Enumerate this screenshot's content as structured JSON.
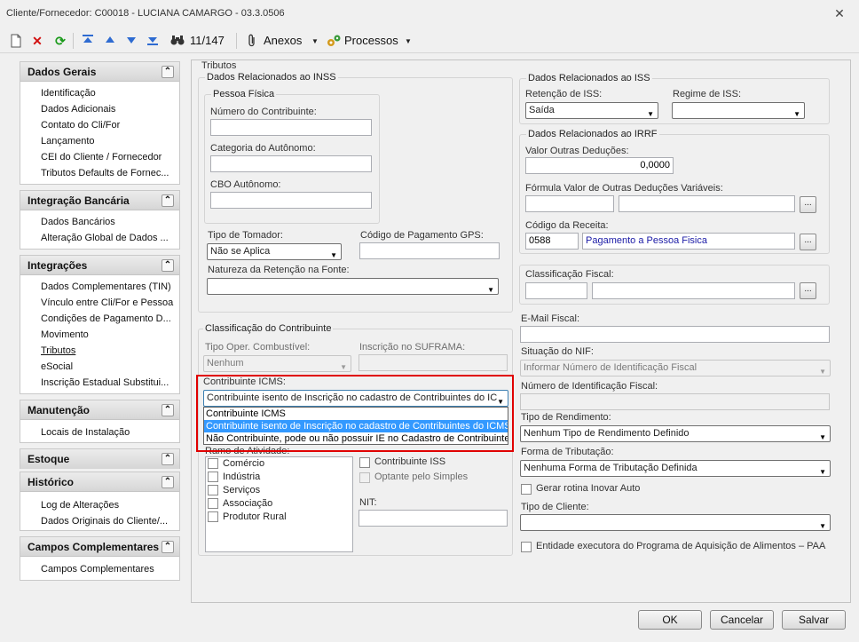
{
  "window": {
    "title": "Cliente/Fornecedor: C00018 - LUCIANA CAMARGO - 03.3.0506"
  },
  "toolbar": {
    "record_counter": "11/147",
    "anexos_label": "Anexos",
    "processos_label": "Processos"
  },
  "sidebar": {
    "dados_gerais": {
      "title": "Dados Gerais",
      "items": [
        "Identificação",
        "Dados Adicionais",
        "Contato do Cli/For",
        "Lançamento",
        "CEI do Cliente / Fornecedor",
        "Tributos Defaults de Fornec..."
      ]
    },
    "integracao_bancaria": {
      "title": "Integração Bancária",
      "items": [
        "Dados Bancários",
        "Alteração Global de Dados ..."
      ]
    },
    "integracoes": {
      "title": "Integrações",
      "items": [
        "Dados Complementares (TIN)",
        "Vínculo entre Cli/For e Pessoa",
        "Condições de Pagamento D...",
        "Movimento",
        "Tributos",
        "eSocial",
        "Inscrição Estadual Substitui..."
      ]
    },
    "manutencao": {
      "title": "Manutenção",
      "items": [
        "Locais de Instalação"
      ]
    },
    "estoque": {
      "title": "Estoque"
    },
    "historico": {
      "title": "Histórico",
      "items": [
        "Log de Alterações",
        "Dados Originais do Cliente/..."
      ]
    },
    "campos": {
      "title": "Campos Complementares",
      "items": [
        "Campos Complementares"
      ]
    }
  },
  "tributos": {
    "title": "Tributos",
    "inss": {
      "title": "Dados Relacionados ao INSS",
      "pessoa_fisica": "Pessoa Física",
      "numero_contribuinte_label": "Número do Contribuinte:",
      "numero_contribuinte_value": "",
      "categoria_autonomo_label": "Categoria do Autônomo:",
      "categoria_autonomo_value": "",
      "cbo_label": "CBO Autônomo:",
      "cbo_value": "",
      "tipo_tomador_label": "Tipo de Tomador:",
      "tipo_tomador_value": "Não se Aplica",
      "codigo_gps_label": "Código de Pagamento GPS:",
      "codigo_gps_value": "",
      "natureza_label": "Natureza da Retenção na Fonte:",
      "natureza_value": ""
    },
    "classificacao": {
      "title": "Classificação do Contribuinte",
      "tipo_oper_label": "Tipo Oper. Combustível:",
      "tipo_oper_value": "Nenhum",
      "suframa_label": "Inscrição no SUFRAMA:",
      "suframa_value": "",
      "contribuinte_icms_label": "Contribuinte ICMS:",
      "contribuinte_icms_value": "Contribuinte isento de Inscrição no cadastro de Contribuintes do IC",
      "icms_options": [
        "Contribuinte ICMS",
        "Contribuinte isento de Inscrição no cadastro de Contribuintes do ICMS",
        "Não Contribuinte, pode ou não possuir IE no Cadastro de Contribuintes"
      ],
      "ramo_label": "Ramo de Atividade:",
      "ramo_items": [
        "Comércio",
        "Indústria",
        "Serviços",
        "Associação",
        "Produtor Rural"
      ],
      "contribuinte_iss_label": "Contribuinte ISS",
      "optante_simples_label": "Optante pelo Simples",
      "nit_label": "NIT:",
      "nit_value": ""
    },
    "iss": {
      "title": "Dados Relacionados ao ISS",
      "retencao_label": "Retenção de ISS:",
      "retencao_value": "Saída",
      "regime_label": "Regime de ISS:",
      "regime_value": ""
    },
    "irrf": {
      "title": "Dados Relacionados ao IRRF",
      "valor_outras_label": "Valor Outras Deduções:",
      "valor_outras_value": "0,0000",
      "formula_label": "Fórmula Valor de Outras Deduções Variáveis:",
      "formula_code": "",
      "formula_desc": "",
      "codigo_receita_label": "Código da Receita:",
      "codigo_receita_code": "0588",
      "codigo_receita_desc": "Pagamento a Pessoa Fisica"
    },
    "classificacao_fiscal": {
      "label": "Classificação Fiscal:",
      "code": "",
      "desc": ""
    },
    "email_fiscal": {
      "label": "E-Mail Fiscal:",
      "value": ""
    },
    "situacao_nif": {
      "label": "Situação do NIF:",
      "value": "Informar Número de Identificação Fiscal"
    },
    "numero_nif": {
      "label": "Número de Identificação Fiscal:",
      "value": ""
    },
    "tipo_rendimento": {
      "label": "Tipo de Rendimento:",
      "value": "Nenhum Tipo de Rendimento Definido"
    },
    "forma_tributacao": {
      "label": "Forma de Tributação:",
      "value": "Nenhuma Forma de Tributação Definida"
    },
    "gerar_rotina_label": "Gerar rotina Inovar Auto",
    "tipo_cliente": {
      "label": "Tipo de Cliente:",
      "value": ""
    },
    "paa_label": "Entidade executora do Programa de Aquisição de Alimentos – PAA"
  },
  "buttons": {
    "ok": "OK",
    "cancel": "Cancelar",
    "save": "Salvar"
  }
}
